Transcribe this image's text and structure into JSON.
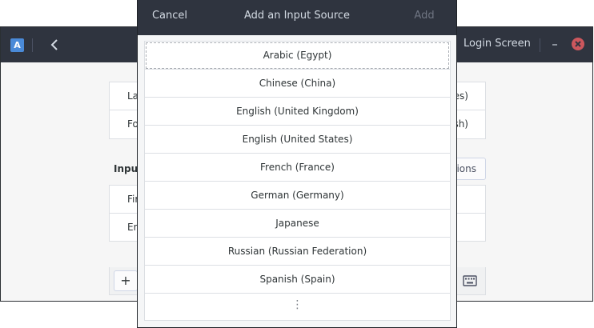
{
  "background": {
    "header": {
      "back_icon": "chevron-left-icon",
      "app_icon_letter": "A",
      "login_screen_label": "Login Screen",
      "minimize_symbol": "–",
      "close_icon": "close-icon"
    },
    "top_list": [
      {
        "label": "La",
        "value": "es)"
      },
      {
        "label": "Fo",
        "value": "sh)"
      }
    ],
    "input_heading": "Input",
    "options_label": "ions",
    "sources": [
      {
        "label": "Fir"
      },
      {
        "label": "En"
      }
    ],
    "add_symbol": "+",
    "keyboard_icon": "keyboard-icon"
  },
  "dialog": {
    "cancel_label": "Cancel",
    "title": "Add an Input Source",
    "add_label": "Add",
    "languages": [
      "Arabic (Egypt)",
      "Chinese (China)",
      "English (United Kingdom)",
      "English (United States)",
      "French (France)",
      "German (Germany)",
      "Japanese",
      "Russian (Russian Federation)",
      "Spanish (Spain)"
    ],
    "more_symbol": "⋮"
  },
  "colors": {
    "headerbar": "#2f343f",
    "header_text": "#d3dae3",
    "close_button": "#cc575d",
    "app_icon": "#4a8ad8"
  }
}
